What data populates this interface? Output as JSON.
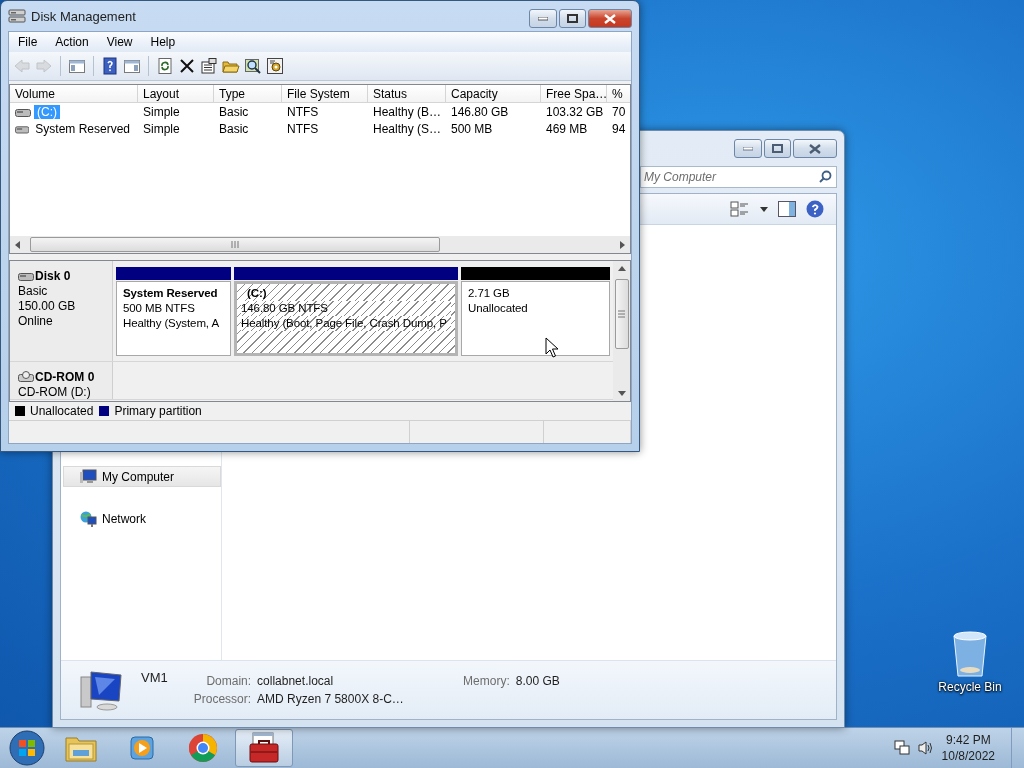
{
  "desktop_icons": [
    {
      "label": "Recycle Bin"
    }
  ],
  "explorer_window": {
    "active": false,
    "search": {
      "placeholder": "My Computer"
    },
    "nav_items": [
      {
        "label": "My Computer",
        "selected": true
      },
      {
        "label": "Network",
        "selected": false
      }
    ],
    "details": {
      "name": "VM1",
      "fields": [
        {
          "label": "Domain:",
          "value": "collabnet.local"
        },
        {
          "label": "Memory:",
          "value": "8.00 GB"
        },
        {
          "label": "Processor:",
          "value": "AMD Ryzen 7 5800X 8-C…"
        }
      ]
    }
  },
  "disk_management": {
    "active": true,
    "title": "Disk Management",
    "menu": [
      "File",
      "Action",
      "View",
      "Help"
    ],
    "toolbar": [
      {
        "kind": "back",
        "disabled": true
      },
      {
        "kind": "forward",
        "disabled": true
      },
      {
        "kind": "separator"
      },
      {
        "kind": "console-tree"
      },
      {
        "kind": "separator"
      },
      {
        "kind": "help"
      },
      {
        "kind": "action-pane"
      },
      {
        "kind": "separator"
      },
      {
        "kind": "refresh"
      },
      {
        "kind": "delete"
      },
      {
        "kind": "properties"
      },
      {
        "kind": "open"
      },
      {
        "kind": "explore"
      },
      {
        "kind": "settings"
      }
    ],
    "columns": [
      "Volume",
      "Layout",
      "Type",
      "File System",
      "Status",
      "Capacity",
      "Free Spa…",
      "%"
    ],
    "rows": [
      {
        "selected": true,
        "cells": [
          "(C:)",
          "Simple",
          "Basic",
          "NTFS",
          "Healthy (B…",
          "146.80 GB",
          "103.32 GB",
          "70"
        ]
      },
      {
        "selected": false,
        "cells": [
          "System Reserved",
          "Simple",
          "Basic",
          "NTFS",
          "Healthy (S…",
          "500 MB",
          "469 MB",
          "94"
        ]
      }
    ],
    "disks": [
      {
        "kind": "disk",
        "name": "Disk 0",
        "details": [
          "Basic",
          "150.00 GB",
          "Online"
        ],
        "partitions": [
          {
            "name": "System Reserved",
            "lines": [
              "500 MB NTFS",
              "Healthy (System, A"
            ],
            "color": "#000080",
            "selected": false
          },
          {
            "name": "(C:)",
            "lines": [
              "146.80 GB NTFS",
              "Healthy (Boot, Page File, Crash Dump, P"
            ],
            "color": "#000080",
            "selected": true
          },
          {
            "lines": [
              "2.71 GB",
              "Unallocated"
            ],
            "color": "#000000",
            "selected": false
          }
        ]
      },
      {
        "kind": "cdrom",
        "name": "CD-ROM 0",
        "details": [
          "CD-ROM (D:)"
        ]
      }
    ],
    "legend": [
      {
        "label": "Unallocated",
        "color": "#000000"
      },
      {
        "label": "Primary partition",
        "color": "#000080"
      }
    ]
  },
  "taskbar": {
    "apps": [
      {
        "kind": "explorer",
        "selected": false
      },
      {
        "kind": "media",
        "selected": false
      },
      {
        "kind": "browser",
        "selected": false
      },
      {
        "kind": "toolbox",
        "selected": true
      }
    ],
    "time": "9:42 PM",
    "date": "10/8/2022"
  }
}
